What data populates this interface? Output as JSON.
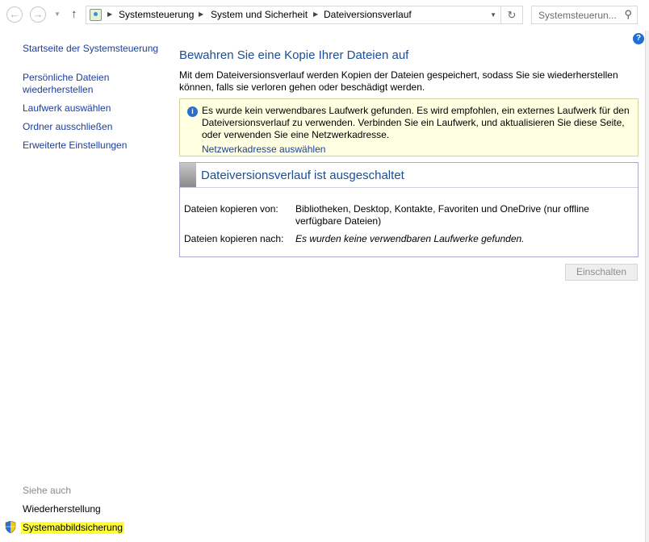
{
  "addressbar": {
    "breadcrumb": [
      "Systemsteuerung",
      "System und Sicherheit",
      "Dateiversionsverlauf"
    ],
    "search_placeholder": "Systemsteuerun..."
  },
  "sidebar": {
    "items": [
      {
        "label": "Startseite der Systemsteuerung"
      },
      {
        "label": "Persönliche Dateien\nwiederherstellen"
      },
      {
        "label": "Laufwerk auswählen"
      },
      {
        "label": "Ordner ausschließen"
      },
      {
        "label": "Erweiterte Einstellungen"
      }
    ],
    "see_also_label": "Siehe auch",
    "see_also": [
      {
        "label": "Wiederherstellung"
      },
      {
        "label": "Systemabbildsicherung"
      }
    ]
  },
  "main": {
    "title": "Bewahren Sie eine Kopie Ihrer Dateien auf",
    "intro": "Mit dem Dateiversionsverlauf werden Kopien der Dateien gespeichert, sodass Sie sie wiederherstellen können, falls sie verloren gehen oder beschädigt werden.",
    "info_text": "Es wurde kein verwendbares Laufwerk gefunden. Es wird empfohlen, ein externes Laufwerk für den Dateiversionsverlauf zu verwenden. Verbinden Sie ein Laufwerk, und aktualisieren Sie diese Seite, oder verwenden Sie eine Netzwerkadresse.",
    "info_link": "Netzwerkadresse auswählen",
    "status_title": "Dateiversionsverlauf ist ausgeschaltet",
    "copy_from_label": "Dateien kopieren von:",
    "copy_from_value": "Bibliotheken, Desktop, Kontakte, Favoriten und OneDrive (nur offline verfügbare Dateien)",
    "copy_to_label": "Dateien kopieren nach:",
    "copy_to_value": "Es wurden keine verwendbaren Laufwerke gefunden.",
    "turn_on_button": "Einschalten"
  },
  "colors": {
    "link": "#1c3e9c",
    "title": "#1c4e93",
    "info_background": "#ffffe1",
    "highlight": "#ffff3a"
  }
}
